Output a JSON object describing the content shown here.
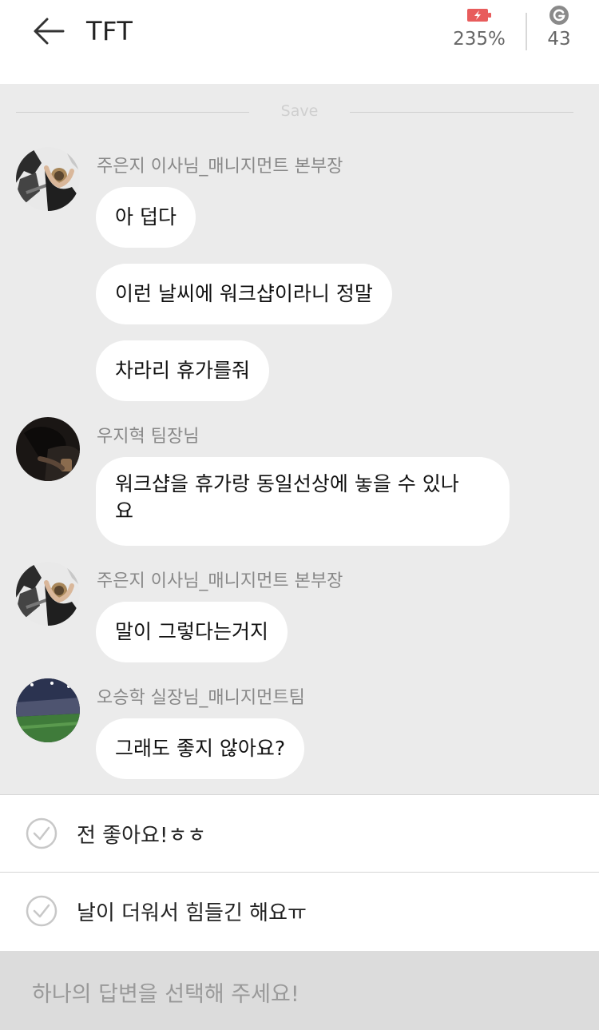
{
  "header": {
    "title": "TFT",
    "battery_value": "235%",
    "coin_value": "43",
    "battery_color": "#e85c5c"
  },
  "separator": {
    "save_label": "Save"
  },
  "messages": [
    {
      "sender": "주은지 이사님_매니지먼트 본부장",
      "bubbles": [
        "아 덥다",
        "이런 날씨에 워크샵이라니 정말",
        "차라리 휴가를줘"
      ]
    },
    {
      "sender": "우지혁 팀장님",
      "bubbles": [
        "워크샵을 휴가랑 동일선상에 놓을 수 있나\n요"
      ]
    },
    {
      "sender": "주은지 이사님_매니지먼트 본부장",
      "bubbles": [
        "말이 그렇다는거지"
      ]
    },
    {
      "sender": "오승학 실장님_매니지먼트팀",
      "bubbles": [
        "그래도 좋지 않아요?"
      ]
    }
  ],
  "answers": [
    {
      "label": "전 좋아요!ㅎㅎ"
    },
    {
      "label": "날이 더워서 힘들긴 해요ㅠ"
    }
  ],
  "footer": {
    "label": "하나의 답변을 선택해 주세요!"
  }
}
